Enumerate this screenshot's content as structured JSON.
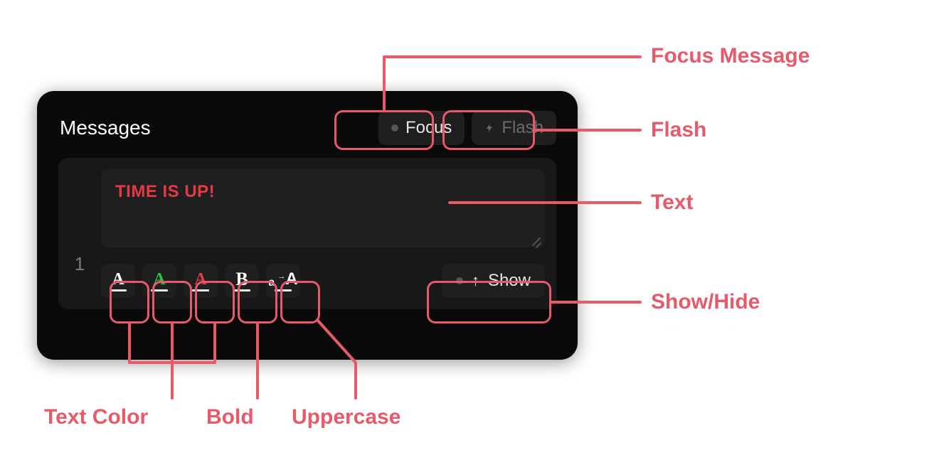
{
  "panel": {
    "title": "Messages",
    "focus_label": "Focus",
    "flash_label": "Flash",
    "show_label": "Show"
  },
  "message": {
    "index": "1",
    "text": "TIME IS UP!"
  },
  "format": {
    "color_white_letter": "A",
    "color_green_letter": "A",
    "color_red_letter": "A",
    "bold_letter": "B",
    "case_small": "a",
    "case_big": "A"
  },
  "annotations": {
    "focus_message": "Focus Message",
    "flash": "Flash",
    "text": "Text",
    "show_hide": "Show/Hide",
    "text_color": "Text Color",
    "bold": "Bold",
    "uppercase": "Uppercase"
  },
  "colors": {
    "accent": "#e85a6a",
    "text_red": "#e63946",
    "text_green": "#2fbf4a"
  }
}
